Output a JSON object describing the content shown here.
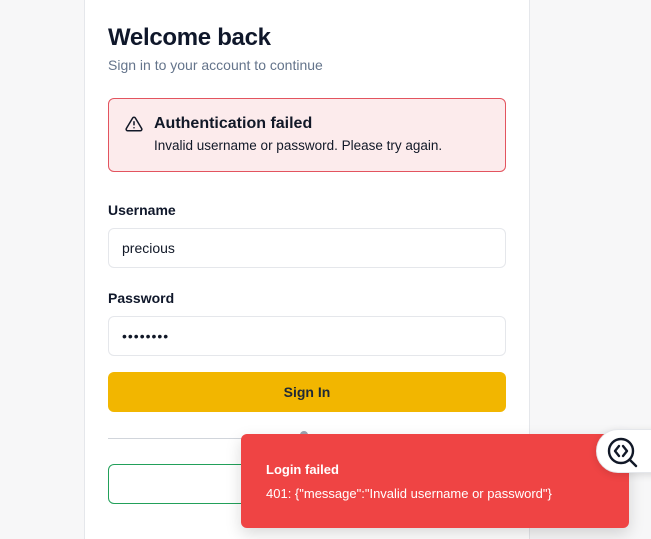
{
  "login": {
    "title": "Welcome back",
    "subtitle": "Sign in to your account to continue",
    "alert": {
      "icon": "warning-triangle-icon",
      "title": "Authentication failed",
      "message": "Invalid username or password. Please try again."
    },
    "username_label": "Username",
    "username_value": "precious",
    "password_label": "Password",
    "password_value": "••••••••",
    "signin_label": "Sign In"
  },
  "toast": {
    "title": "Login failed",
    "message": "401: {\"message\":\"Invalid username or password\"}"
  },
  "fab": {
    "icon": "code-search-icon"
  },
  "colors": {
    "primary_button": "#f2b600",
    "alert_bg": "#fcebec",
    "alert_border": "#e3545f",
    "toast_bg": "#ef4444",
    "outline_button_border": "#22a05a"
  }
}
